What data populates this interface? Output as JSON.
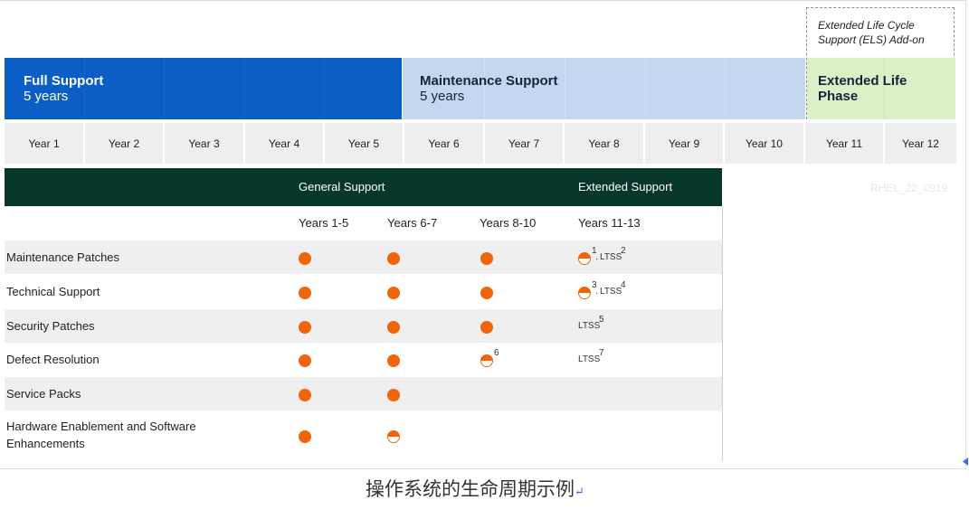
{
  "els": {
    "title": "Extended Life Cycle Support (ELS) Add-on"
  },
  "phases": {
    "full": {
      "title": "Full Support",
      "sub": "5 years",
      "color": "#0a5ec6"
    },
    "maintenance": {
      "title": "Maintenance Support",
      "sub": "5 years",
      "color": "#c4d7ee"
    },
    "extended": {
      "title": "Extended Life Phase",
      "color": "#dcefc6"
    }
  },
  "years": [
    "Year 1",
    "Year 2",
    "Year 3",
    "Year 4",
    "Year 5",
    "Year 6",
    "Year 7",
    "Year 8",
    "Year 9",
    "Year 10",
    "Year 11",
    "Year 12"
  ],
  "table": {
    "header": {
      "general": "General Support",
      "extended": "Extended Support"
    },
    "watermark": "RHEL_22_0919",
    "subheaders": [
      "Years 1-5",
      "Years 6-7",
      "Years 8-10",
      "Years 11-13"
    ],
    "rows": [
      {
        "label": "Maintenance Patches",
        "cells": [
          "full",
          "full",
          "full",
          ""
        ],
        "notes": [
          "",
          "",
          "",
          ""
        ],
        "ext": {
          "note": "1",
          "ltss": "LTSS",
          "ltss_note": "2"
        }
      },
      {
        "label": "Technical Support",
        "cells": [
          "full",
          "full",
          "full",
          ""
        ],
        "notes": [
          "",
          "",
          "",
          ""
        ],
        "ext": {
          "note": "3",
          "ltss": "LTSS",
          "ltss_note": "4"
        }
      },
      {
        "label": "Security Patches",
        "cells": [
          "full",
          "full",
          "full",
          ""
        ],
        "notes": [
          "",
          "",
          "",
          ""
        ],
        "ext": {
          "ltss": "LTSS",
          "ltss_note": "5"
        }
      },
      {
        "label": "Defect Resolution",
        "cells": [
          "full",
          "full",
          "half",
          ""
        ],
        "notes": [
          "",
          "",
          "6",
          ""
        ],
        "ext": {
          "ltss": "LTSS",
          "ltss_note": "7"
        }
      },
      {
        "label": "Service Packs",
        "cells": [
          "full",
          "full",
          "",
          ""
        ],
        "notes": [
          "",
          "",
          "",
          ""
        ]
      },
      {
        "label": "Hardware Enablement and Software Enhancements",
        "cells": [
          "full",
          "half",
          "",
          ""
        ],
        "notes": [
          "",
          "",
          "",
          ""
        ]
      }
    ],
    "colors": {
      "header_bg": "#06372a",
      "dot": "#f0650a",
      "row_alt": "#efefef"
    }
  },
  "caption": "操作系统的生命周期示例",
  "caption_mark": "↵"
}
